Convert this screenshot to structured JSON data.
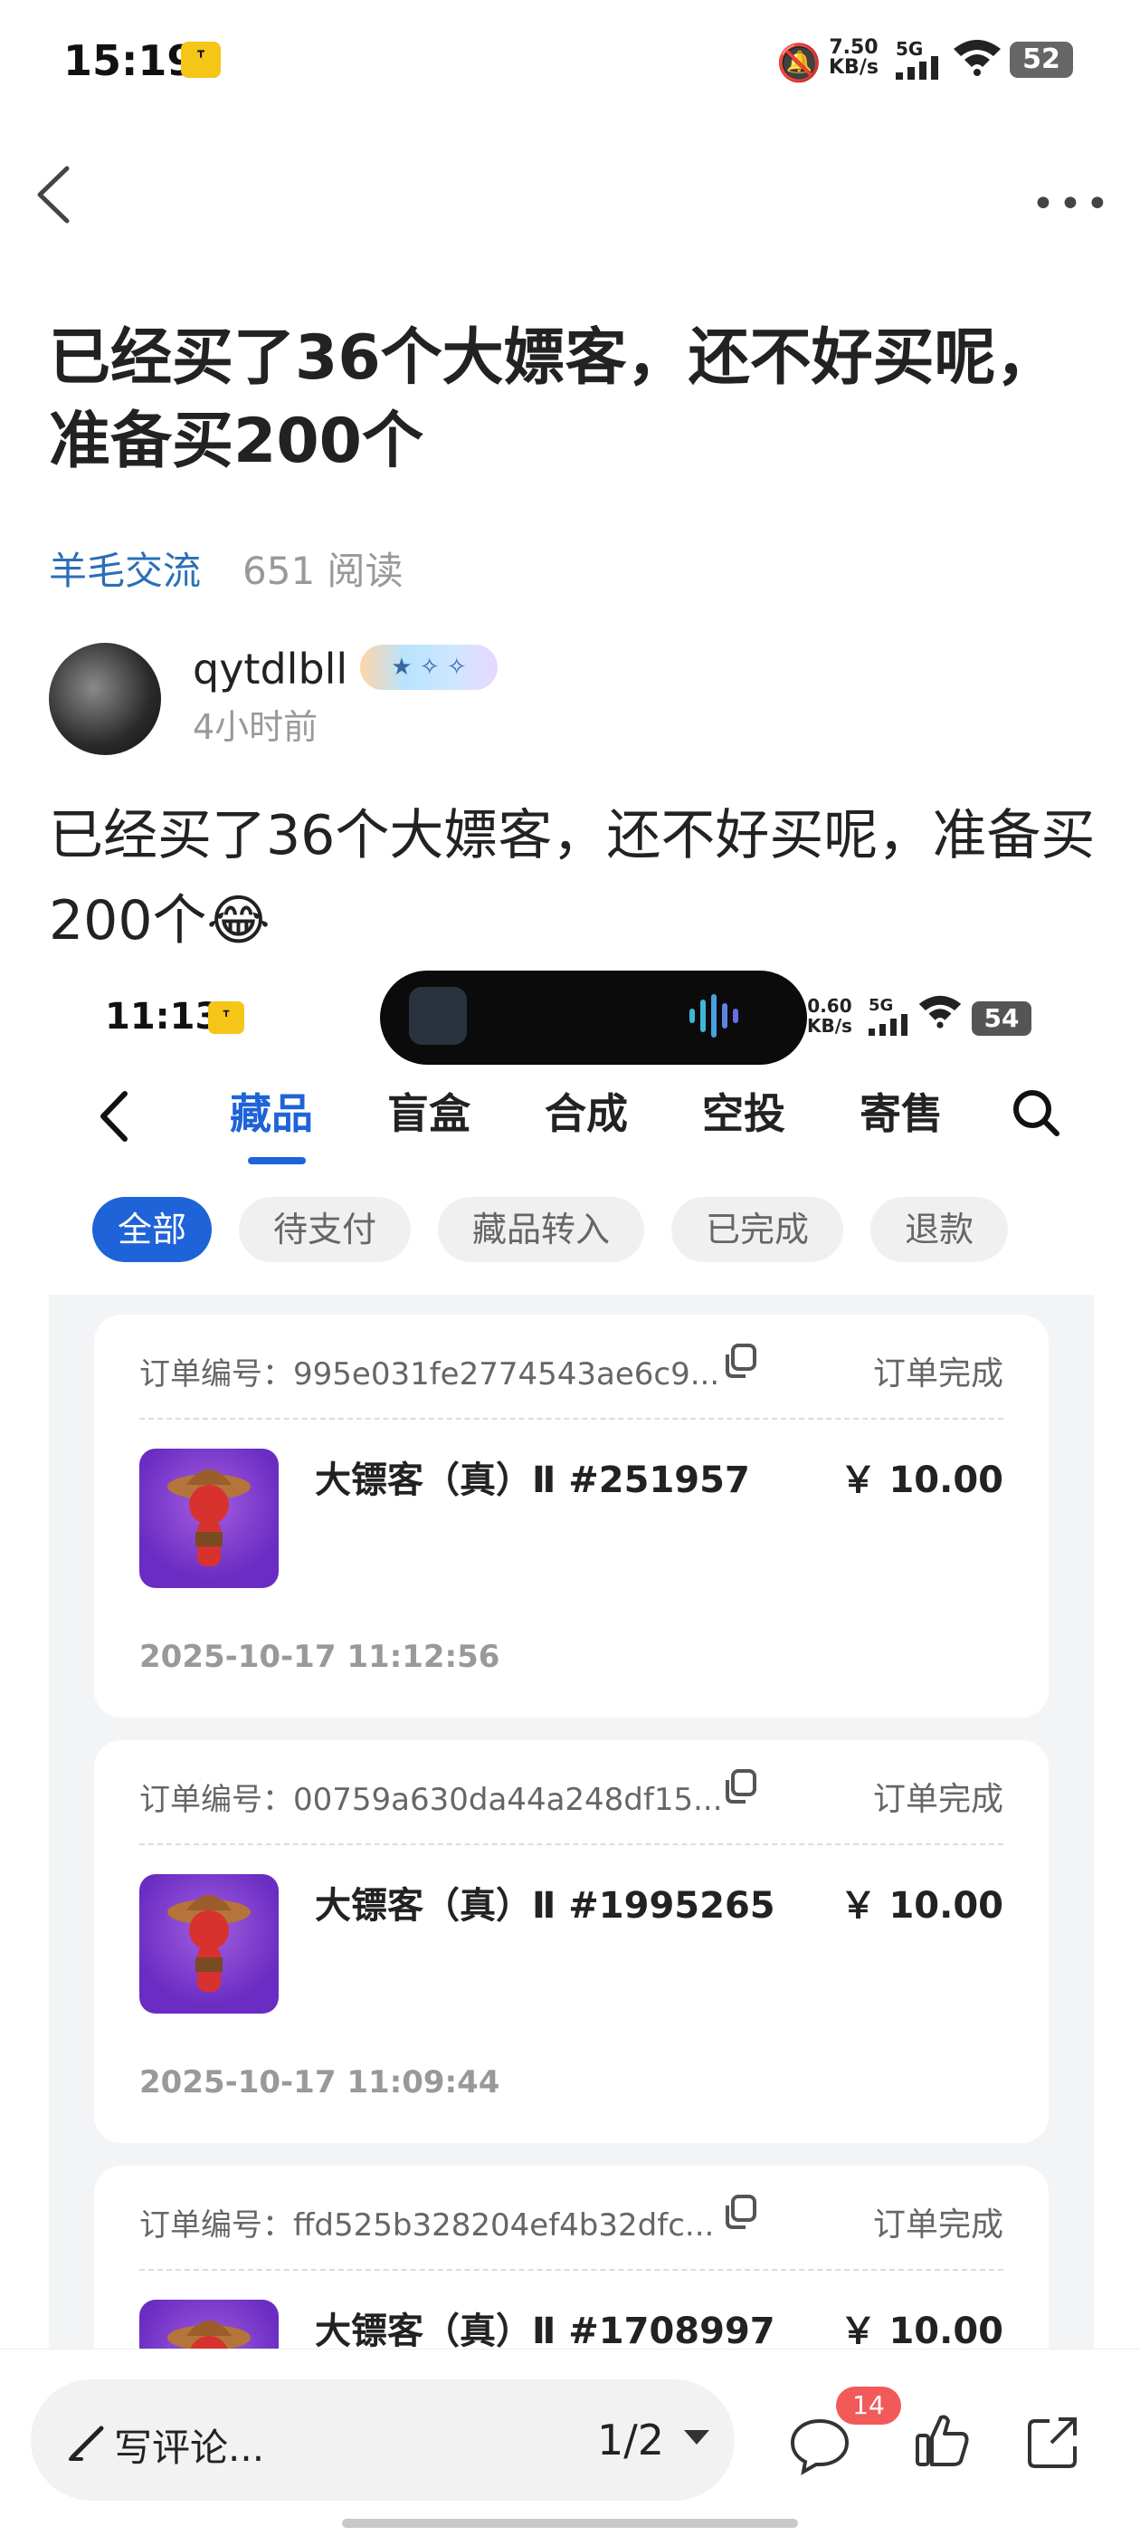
{
  "status_bar": {
    "time": "15:19",
    "net_speed": "7.50",
    "net_unit": "KB/s",
    "network": "5G",
    "battery": "52"
  },
  "post": {
    "title": "已经买了36个大嫖客，还不好买呢，准备买200个",
    "category": "羊毛交流",
    "reads": "651 阅读",
    "author": "qytdlbll",
    "time_ago": "4小时前",
    "body": "已经买了36个大嫖客，还不好买呢，准备买200个😂"
  },
  "embedded": {
    "status_bar": {
      "time": "11:13",
      "net_speed": "0.60",
      "net_unit": "KB/s",
      "network": "5G",
      "battery": "54"
    },
    "tabs": [
      "藏品",
      "盲盒",
      "合成",
      "空投",
      "寄售"
    ],
    "active_tab": 0,
    "filters": [
      "全部",
      "待支付",
      "藏品转入",
      "已完成",
      "退款"
    ],
    "orders": [
      {
        "id_label": "订单编号：995e031fe2774543ae6c9...",
        "status": "订单完成",
        "name": "大镖客（真）Ⅱ #251957",
        "price": "￥ 10.00",
        "date": "2025-10-17 11:12:56"
      },
      {
        "id_label": "订单编号：00759a630da44a248df15...",
        "status": "订单完成",
        "name": "大镖客（真）Ⅱ #1995265",
        "price": "￥ 10.00",
        "date": "2025-10-17 11:09:44"
      },
      {
        "id_label": "订单编号：ffd525b328204ef4b32dfc...",
        "status": "订单完成",
        "name": "大镖客（真）Ⅱ #1708997",
        "price": "￥ 10.00",
        "date": ""
      }
    ]
  },
  "bottom": {
    "comment_placeholder": "写评论...",
    "page": "1/2",
    "comment_count": "14"
  }
}
